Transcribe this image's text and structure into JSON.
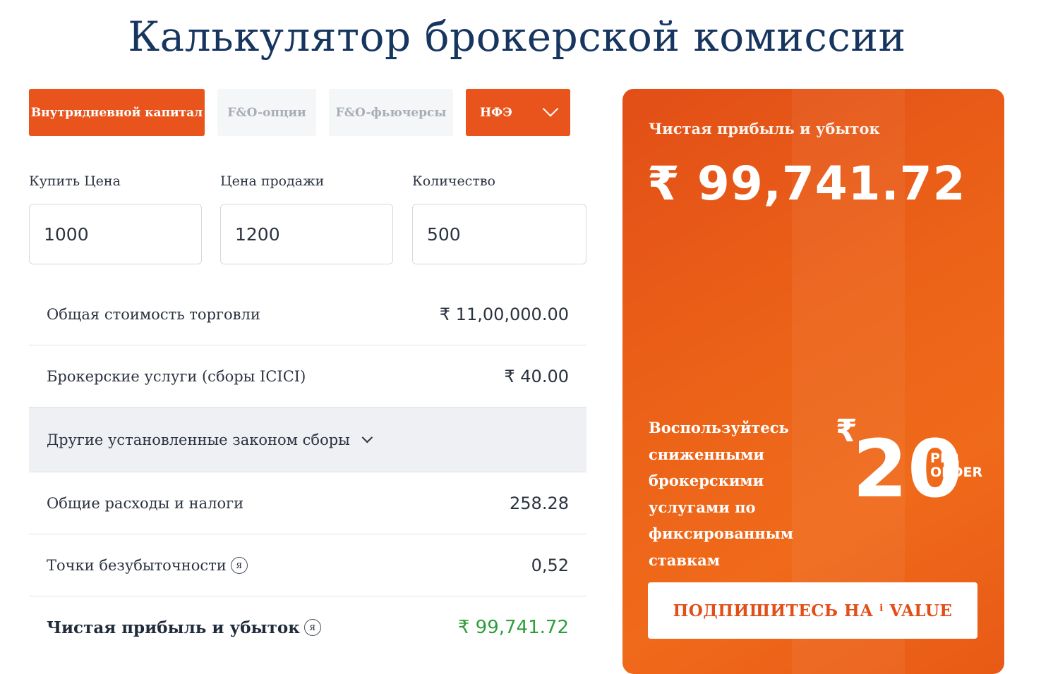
{
  "page": {
    "title": "Калькулятор брокерской комиссии"
  },
  "tabs": [
    {
      "label": "Внутридневной капитал",
      "state": "active"
    },
    {
      "label": "F&O-опции",
      "state": "inactive"
    },
    {
      "label": "F&O-фьючерсы",
      "state": "inactive"
    },
    {
      "label": "НФЭ",
      "state": "dropdown"
    }
  ],
  "inputs": {
    "buy_price": {
      "label": "Купить Цена",
      "value": "1000"
    },
    "sell_price": {
      "label": "Цена продажи",
      "value": "1200"
    },
    "quantity": {
      "label": "Количество",
      "value": "500"
    }
  },
  "rows": [
    {
      "label": "Общая стоимость торговли",
      "value": "₹ 11,00,000.00"
    },
    {
      "label": "Брокерские услуги (сборы ICICI)",
      "value": "₹ 40.00"
    },
    {
      "label": "Другие установленные законом сборы"
    },
    {
      "label": "Общие расходы и налоги",
      "value": "258.28"
    },
    {
      "label": "Точки безубыточности",
      "value": "0,52",
      "info": "я"
    },
    {
      "label": "Чистая прибыль и убыток",
      "value": "₹ 99,741.72",
      "info": "я"
    }
  ],
  "panel": {
    "title": "Чистая прибыль и убыток",
    "amount": "₹ 99,741.72",
    "promo_text": "Воспользуйтесь сниженными брокерскими услугами по фиксированным ставкам",
    "promo_graphic": {
      "symbol": "₹",
      "number": "20",
      "line1": "PER",
      "line2": "ORDER"
    },
    "button_label": "ПОДПИШИТЕСЬ НА ⁱ VALUE"
  },
  "colors": {
    "accent": "#e8541c",
    "title": "#17365f",
    "positive": "#2e9e3c",
    "inactive_tab_bg": "#f5f6f7"
  }
}
